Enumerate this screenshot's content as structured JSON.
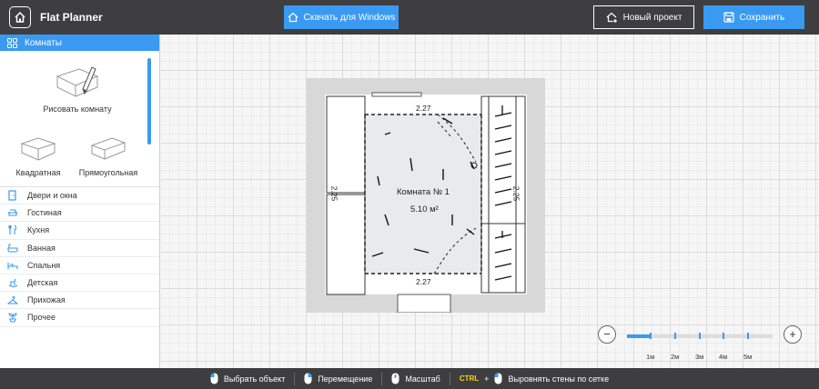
{
  "header": {
    "brand": "Flat Planner",
    "download_label": "Скачать для Windows",
    "new_project_label": "Новый проект",
    "save_label": "Сохранить"
  },
  "sidebar": {
    "section_title": "Комнаты",
    "tools": {
      "draw": "Рисовать комнату",
      "square": "Квадратная",
      "rectangle": "Прямоугольная"
    },
    "categories": [
      {
        "label": "Двери и окна",
        "icon": "door-icon"
      },
      {
        "label": "Гостиная",
        "icon": "sofa-icon"
      },
      {
        "label": "Кухня",
        "icon": "utensils-icon"
      },
      {
        "label": "Ванная",
        "icon": "bathtub-icon"
      },
      {
        "label": "Спальня",
        "icon": "bed-icon"
      },
      {
        "label": "Детская",
        "icon": "rocking-horse-icon"
      },
      {
        "label": "Прихожая",
        "icon": "hanger-icon"
      },
      {
        "label": "Прочее",
        "icon": "plant-icon"
      }
    ]
  },
  "plan": {
    "room_name": "Комната № 1",
    "room_area": "5.10 м²",
    "dim_top": "2.27",
    "dim_bottom": "2.27",
    "dim_left": "2.25",
    "dim_right": "2.25"
  },
  "zoom": {
    "minus": "−",
    "plus": "+",
    "scale_labels": [
      "1м",
      "2м",
      "3м",
      "4м",
      "5м"
    ],
    "level_fraction": 0.17
  },
  "footer": {
    "select": "Выбрать объект",
    "move": "Перемещение",
    "scale": "Масштаб",
    "ctrl_key": "CTRL",
    "plus": "+",
    "align": "Выровнять стены по сетке"
  },
  "colors": {
    "accent": "#3a9af2",
    "bar": "#3e3e40"
  }
}
